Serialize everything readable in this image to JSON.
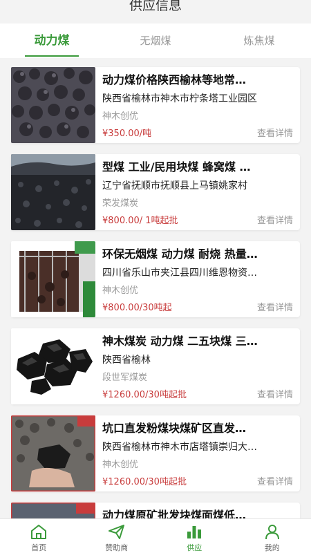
{
  "header": {
    "title": "供应信息"
  },
  "tabs": [
    {
      "label": "动力煤",
      "active": true
    },
    {
      "label": "无烟煤",
      "active": false
    },
    {
      "label": "炼焦煤",
      "active": false
    }
  ],
  "items": [
    {
      "name": "动力煤价格陕西榆林等地常…",
      "address": "陕西省榆林市神木市柠条塔工业园区",
      "company": "神木创优",
      "price": "¥350.00/吨",
      "detail": "查看详情"
    },
    {
      "name": "型煤 工业/民用块煤 蜂窝煤 …",
      "address": "辽宁省抚顺市抚顺县上马镇姚家村",
      "company": "荣发煤炭",
      "price": "¥800.00/ 1吨起批",
      "detail": "查看详情"
    },
    {
      "name": "环保无烟煤 动力煤 耐烧 热量…",
      "address": "四川省乐山市夹江县四川维恩物资…",
      "company": "神木创优",
      "price": "¥800.00/30吨起",
      "detail": "查看详情"
    },
    {
      "name": "神木煤炭 动力煤 二五块煤 三…",
      "address": "陕西省榆林",
      "company": "段世军煤炭",
      "price": "¥1260.00/30吨起批",
      "detail": "查看详情"
    },
    {
      "name": "坑口直发粉煤块煤矿区直发…",
      "address": "陕西省榆林市神木市店塔镇崇归大…",
      "company": "神木创优",
      "price": "¥1260.00/30吨起批",
      "detail": "查看详情"
    },
    {
      "name": "动力煤原矿批发块煤面煤低…",
      "address": "",
      "company": "",
      "price": "",
      "detail": ""
    }
  ],
  "nav": [
    {
      "label": "首页",
      "icon": "home-icon"
    },
    {
      "label": "赞助商",
      "icon": "paper-plane-icon"
    },
    {
      "label": "供应",
      "icon": "bar-chart-icon",
      "active": true
    },
    {
      "label": "我的",
      "icon": "user-icon"
    }
  ],
  "colors": {
    "accent": "#3a9a3a",
    "price": "#c83c3c"
  }
}
